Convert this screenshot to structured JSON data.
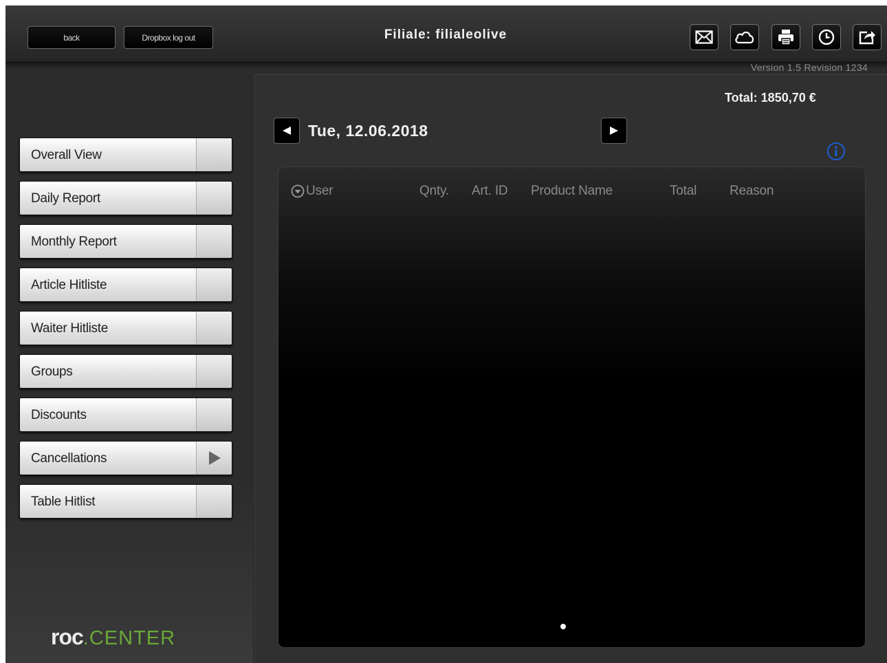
{
  "header": {
    "back_label": "back",
    "dropbox_label": "Dropbox log out",
    "title": "Filiale: filialeolive",
    "version": "Version 1.5 Revision 1234",
    "tools": [
      "mail-icon",
      "cloud-icon",
      "printer-icon",
      "clock-icon",
      "export-icon"
    ]
  },
  "sidebar": {
    "items": [
      {
        "label": "Overall View",
        "arrow": false
      },
      {
        "label": "Daily Report",
        "arrow": false
      },
      {
        "label": "Monthly Report",
        "arrow": false
      },
      {
        "label": "Article Hitliste",
        "arrow": false
      },
      {
        "label": "Waiter Hitliste",
        "arrow": false
      },
      {
        "label": "Groups",
        "arrow": false
      },
      {
        "label": "Discounts",
        "arrow": false
      },
      {
        "label": "Cancellations",
        "arrow": true
      },
      {
        "label": "Table Hitlist",
        "arrow": false
      }
    ],
    "logo": {
      "part1": "roc",
      "part2": ".CENTER"
    }
  },
  "main": {
    "total": "Total: 1850,70 €",
    "date": "Tue, 12.06.2018",
    "columns": [
      "User",
      "Qnty.",
      "Art. ID",
      "Product Name",
      "Total",
      "Reason"
    ],
    "rows": []
  },
  "colors": {
    "accent_green": "#6aa83a",
    "info_blue": "#1a5fd0"
  }
}
